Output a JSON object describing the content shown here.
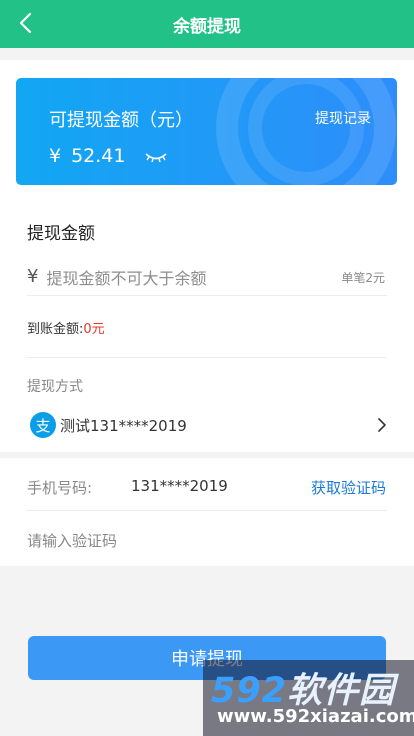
{
  "header": {
    "title": "余额提现"
  },
  "card": {
    "label": "可提现金额（元）",
    "record": "提现记录",
    "currency": "¥",
    "balance": "52.41"
  },
  "amount": {
    "title": "提现金额",
    "currency": "¥",
    "placeholder": "提现金额不可大于余额",
    "single_note": "单笔2元",
    "arrive_label": "到账金额:",
    "arrive_value": "0元"
  },
  "method": {
    "label": "提现方式",
    "alipay_glyph": "支",
    "account": "测试131****2019"
  },
  "phone": {
    "label": "手机号码:",
    "number": "131****2019",
    "get_code": "获取验证码",
    "code_placeholder": "请输入验证码"
  },
  "submit": {
    "label": "申请提现"
  },
  "watermark": {
    "big_num": "592",
    "big_text": "软件园",
    "small": "www.592xiazai.com"
  },
  "colors": {
    "header": "#22c187",
    "card": "#11a7f3",
    "button": "#3b98f5",
    "link": "#1b7bd6",
    "red": "#e5352b"
  }
}
